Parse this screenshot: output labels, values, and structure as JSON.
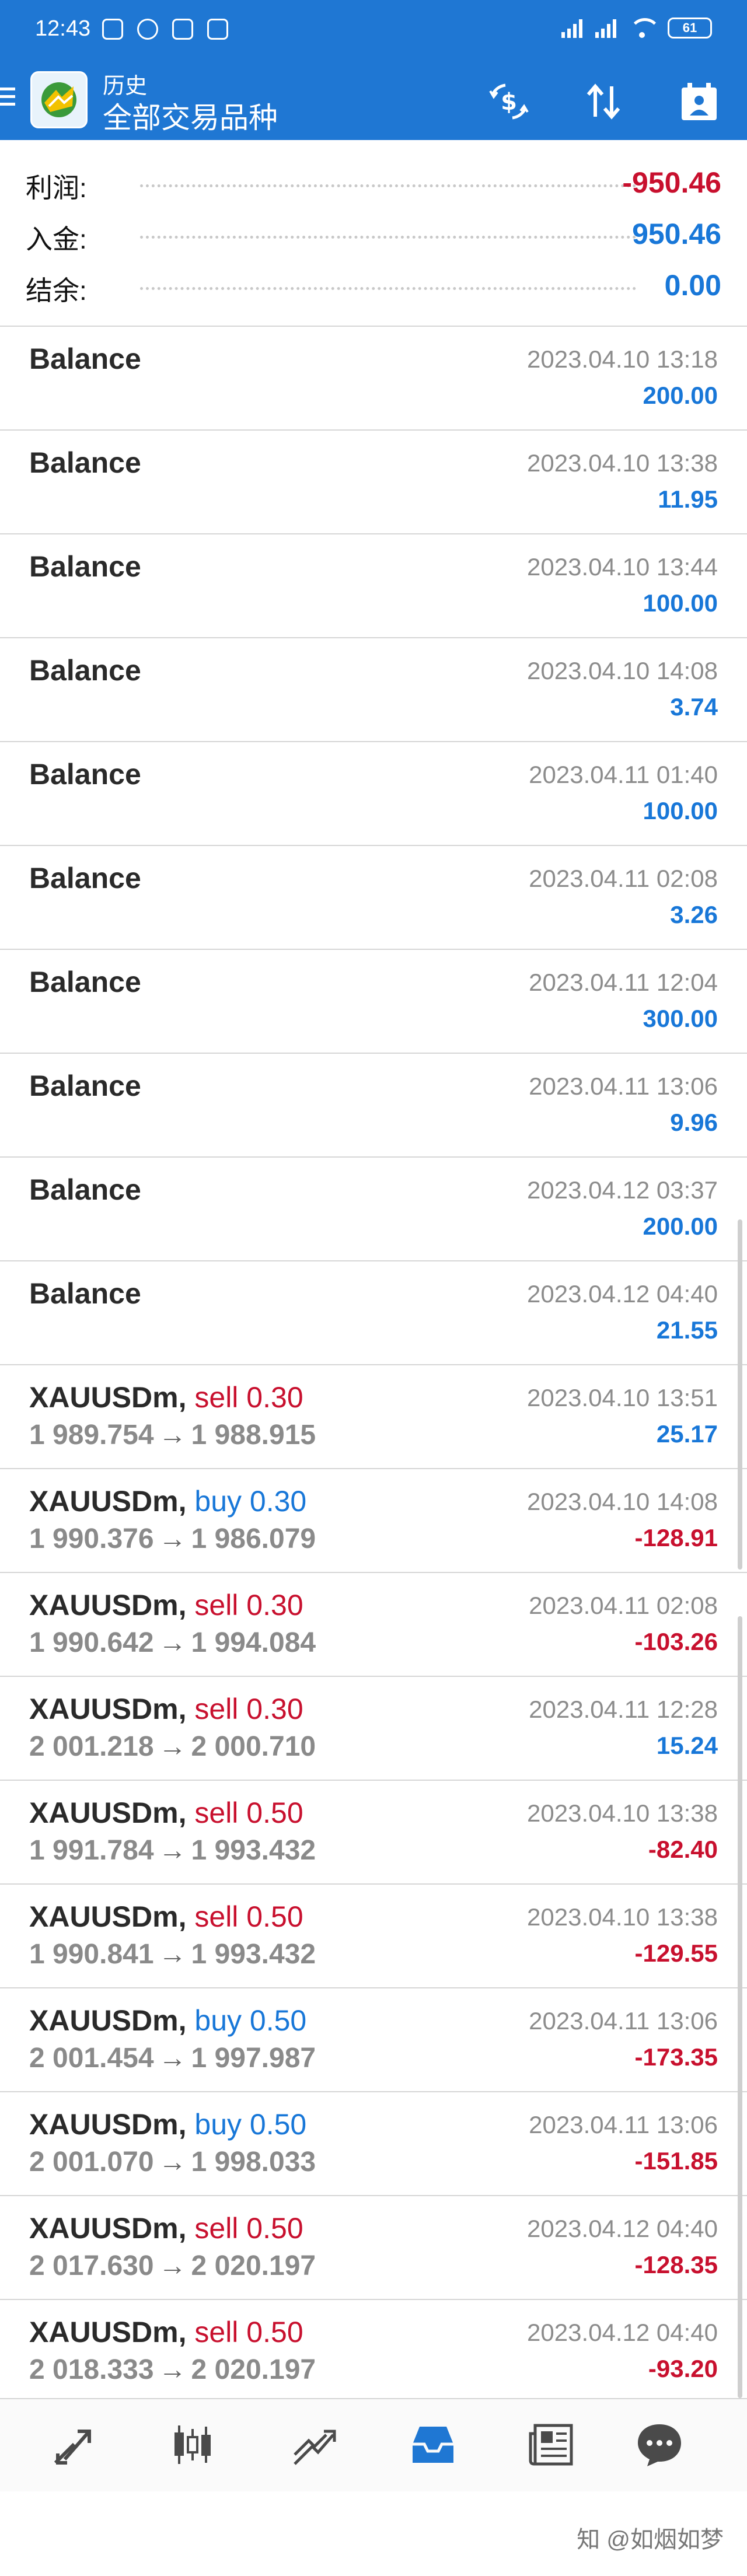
{
  "status_bar": {
    "time": "12:43",
    "battery": "61"
  },
  "app_bar": {
    "subtitle": "历史",
    "title": "全部交易品种"
  },
  "summary": [
    {
      "label": "利润:",
      "value": "-950.46",
      "color": "red"
    },
    {
      "label": "入金:",
      "value": "950.46",
      "color": "blue"
    },
    {
      "label": "结余:",
      "value": "0.00",
      "color": "blue"
    }
  ],
  "deals": [
    {
      "kind": "balance",
      "title": "Balance",
      "date": "2023.04.10 13:18",
      "amount": "200.00",
      "color": "blue"
    },
    {
      "kind": "balance",
      "title": "Balance",
      "date": "2023.04.10 13:38",
      "amount": "11.95",
      "color": "blue"
    },
    {
      "kind": "balance",
      "title": "Balance",
      "date": "2023.04.10 13:44",
      "amount": "100.00",
      "color": "blue"
    },
    {
      "kind": "balance",
      "title": "Balance",
      "date": "2023.04.10 14:08",
      "amount": "3.74",
      "color": "blue"
    },
    {
      "kind": "balance",
      "title": "Balance",
      "date": "2023.04.11 01:40",
      "amount": "100.00",
      "color": "blue"
    },
    {
      "kind": "balance",
      "title": "Balance",
      "date": "2023.04.11 02:08",
      "amount": "3.26",
      "color": "blue"
    },
    {
      "kind": "balance",
      "title": "Balance",
      "date": "2023.04.11 12:04",
      "amount": "300.00",
      "color": "blue"
    },
    {
      "kind": "balance",
      "title": "Balance",
      "date": "2023.04.11 13:06",
      "amount": "9.96",
      "color": "blue"
    },
    {
      "kind": "balance",
      "title": "Balance",
      "date": "2023.04.12 03:37",
      "amount": "200.00",
      "color": "blue"
    },
    {
      "kind": "balance",
      "title": "Balance",
      "date": "2023.04.12 04:40",
      "amount": "21.55",
      "color": "blue"
    },
    {
      "kind": "trade",
      "symbol": "XAUUSDm,",
      "direction": "sell 0.30",
      "dir": "sell",
      "open": "1 989.754",
      "close": "1 988.915",
      "date": "2023.04.10 13:51",
      "amount": "25.17",
      "color": "blue"
    },
    {
      "kind": "trade",
      "symbol": "XAUUSDm,",
      "direction": "buy 0.30",
      "dir": "buy",
      "open": "1 990.376",
      "close": "1 986.079",
      "date": "2023.04.10 14:08",
      "amount": "-128.91",
      "color": "red"
    },
    {
      "kind": "trade",
      "symbol": "XAUUSDm,",
      "direction": "sell 0.30",
      "dir": "sell",
      "open": "1 990.642",
      "close": "1 994.084",
      "date": "2023.04.11 02:08",
      "amount": "-103.26",
      "color": "red"
    },
    {
      "kind": "trade",
      "symbol": "XAUUSDm,",
      "direction": "sell 0.30",
      "dir": "sell",
      "open": "2 001.218",
      "close": "2 000.710",
      "date": "2023.04.11 12:28",
      "amount": "15.24",
      "color": "blue"
    },
    {
      "kind": "trade",
      "symbol": "XAUUSDm,",
      "direction": "sell 0.50",
      "dir": "sell",
      "open": "1 991.784",
      "close": "1 993.432",
      "date": "2023.04.10 13:38",
      "amount": "-82.40",
      "color": "red"
    },
    {
      "kind": "trade",
      "symbol": "XAUUSDm,",
      "direction": "sell 0.50",
      "dir": "sell",
      "open": "1 990.841",
      "close": "1 993.432",
      "date": "2023.04.10 13:38",
      "amount": "-129.55",
      "color": "red"
    },
    {
      "kind": "trade",
      "symbol": "XAUUSDm,",
      "direction": "buy 0.50",
      "dir": "buy",
      "open": "2 001.454",
      "close": "1 997.987",
      "date": "2023.04.11 13:06",
      "amount": "-173.35",
      "color": "red"
    },
    {
      "kind": "trade",
      "symbol": "XAUUSDm,",
      "direction": "buy 0.50",
      "dir": "buy",
      "open": "2 001.070",
      "close": "1 998.033",
      "date": "2023.04.11 13:06",
      "amount": "-151.85",
      "color": "red"
    },
    {
      "kind": "trade",
      "symbol": "XAUUSDm,",
      "direction": "sell 0.50",
      "dir": "sell",
      "open": "2 017.630",
      "close": "2 020.197",
      "date": "2023.04.12 04:40",
      "amount": "-128.35",
      "color": "red"
    },
    {
      "kind": "trade",
      "symbol": "XAUUSDm,",
      "direction": "sell 0.50",
      "dir": "sell",
      "open": "2 018.333",
      "close": "2 020.197",
      "date": "2023.04.12 04:40",
      "amount": "-93.20",
      "color": "red"
    }
  ],
  "arrow_glyph": "→",
  "bottom_nav": [
    {
      "icon": "quotes-icon",
      "active": false
    },
    {
      "icon": "chart-icon",
      "active": false
    },
    {
      "icon": "trade-icon",
      "active": false
    },
    {
      "icon": "history-icon",
      "active": true
    },
    {
      "icon": "news-icon",
      "active": false
    },
    {
      "icon": "messages-icon",
      "active": false
    }
  ],
  "watermark": "知 @如烟如梦",
  "colors": {
    "header_bg": "#1f77d3",
    "profit_blue": "#1877d8",
    "loss_red": "#c8102e",
    "nav_active": "#1f77d3",
    "nav_inactive": "#4a4a4a"
  }
}
